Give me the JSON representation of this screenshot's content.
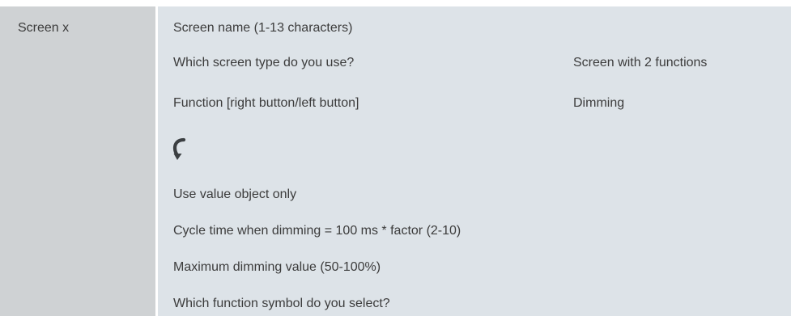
{
  "left_panel": {
    "screen_label": "Screen x"
  },
  "params": [
    {
      "label": "Screen name (1-13 characters)",
      "value": ""
    },
    {
      "label": "Which screen type do you use?",
      "value": "Screen with 2 functions"
    },
    {
      "label": "Function [right button/left button]",
      "value": "Dimming"
    },
    {
      "label": "Use value object only",
      "value": ""
    },
    {
      "label": "Cycle time when dimming = 100 ms * factor (2-10)",
      "value": ""
    },
    {
      "label": "Maximum dimming value (50-100%)",
      "value": ""
    },
    {
      "label": "Which function symbol do you select?",
      "value": ""
    }
  ],
  "icons": {
    "indicator": "curved-down-arrow-icon"
  },
  "colors": {
    "left_panel_bg": "#cfd2d4",
    "right_panel_bg": "#dde3e8",
    "text": "#3c3c3c",
    "icon_dark": "#3b3f42"
  }
}
